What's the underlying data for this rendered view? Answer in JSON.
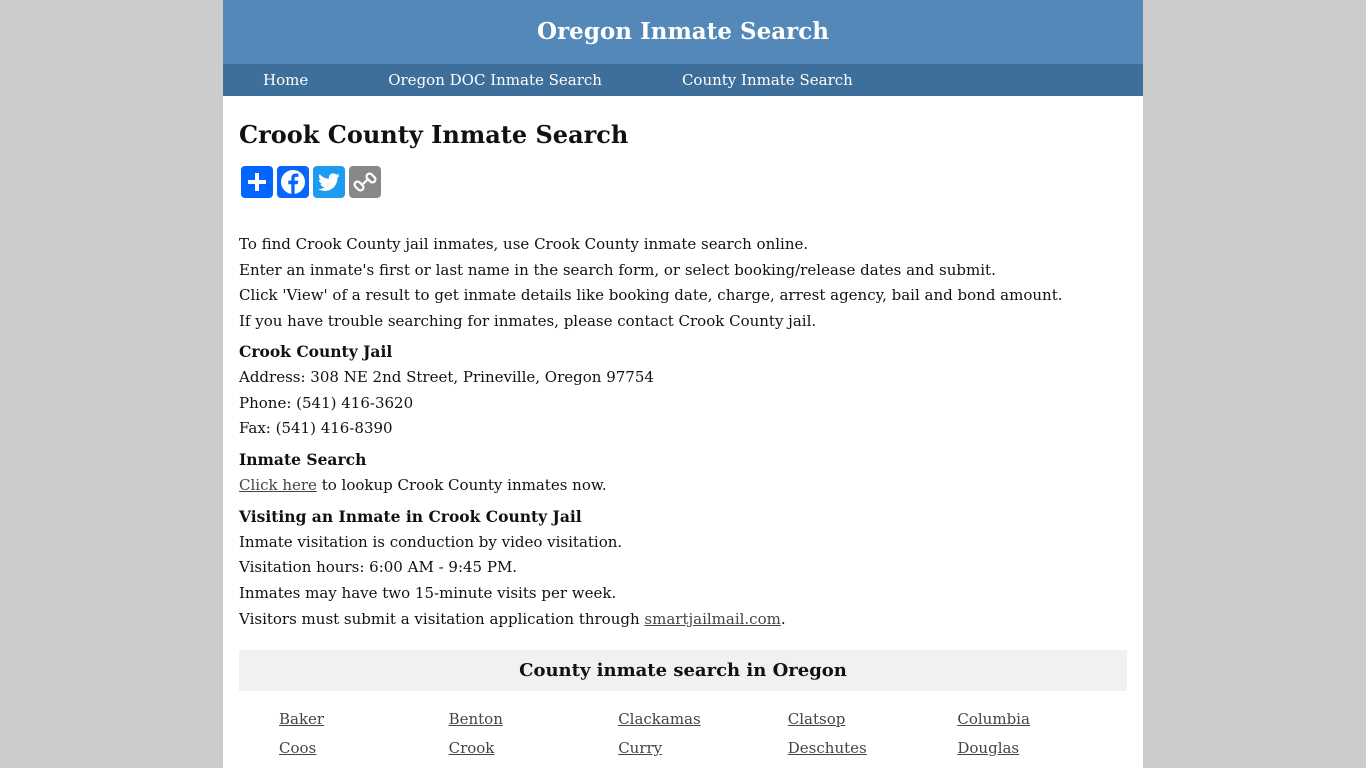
{
  "site": {
    "title": "Oregon Inmate Search"
  },
  "nav": [
    {
      "label": "Home"
    },
    {
      "label": "Oregon DOC Inmate Search"
    },
    {
      "label": "County Inmate Search"
    }
  ],
  "page_title": "Crook County Inmate Search",
  "share": {
    "buttons": [
      {
        "icon": "plus-icon",
        "color": "#0166ff"
      },
      {
        "icon": "facebook-icon",
        "color": "#0866ff"
      },
      {
        "icon": "twitter-icon",
        "color": "#1d9bf0"
      },
      {
        "icon": "copy-link-icon",
        "color": "#888888"
      }
    ]
  },
  "intro": [
    "To find Crook County jail inmates, use Crook County inmate search online.",
    "Enter an inmate's first or last name in the search form, or select booking/release dates and submit.",
    "Click 'View' of a result to get inmate details like booking date, charge, arrest agency, bail and bond amount.",
    "If you have trouble searching for inmates, please contact Crook County jail."
  ],
  "jail": {
    "heading": "Crook County Jail",
    "address": "Address: 308 NE 2nd Street, Prineville, Oregon 97754",
    "phone": "Phone: (541) 416-3620",
    "fax": "Fax: (541) 416-8390"
  },
  "search": {
    "heading": "Inmate Search",
    "link": "Click here",
    "text": " to lookup Crook County inmates now."
  },
  "visiting": {
    "heading": "Visiting an Inmate in Crook County Jail",
    "line1": "Inmate visitation is conduction by video visitation.",
    "line2": "Visitation hours: 6:00 AM - 9:45 PM.",
    "line3": "Inmates may have two 15-minute visits per week.",
    "line4_text": "Visitors must submit a visitation application through ",
    "line4_link": "smartjailmail.com",
    "line4_end": "."
  },
  "counties": {
    "heading": "County inmate search in Oregon",
    "items": [
      "Baker",
      "Benton",
      "Clackamas",
      "Clatsop",
      "Columbia",
      "Coos",
      "Crook",
      "Curry",
      "Deschutes",
      "Douglas"
    ]
  }
}
